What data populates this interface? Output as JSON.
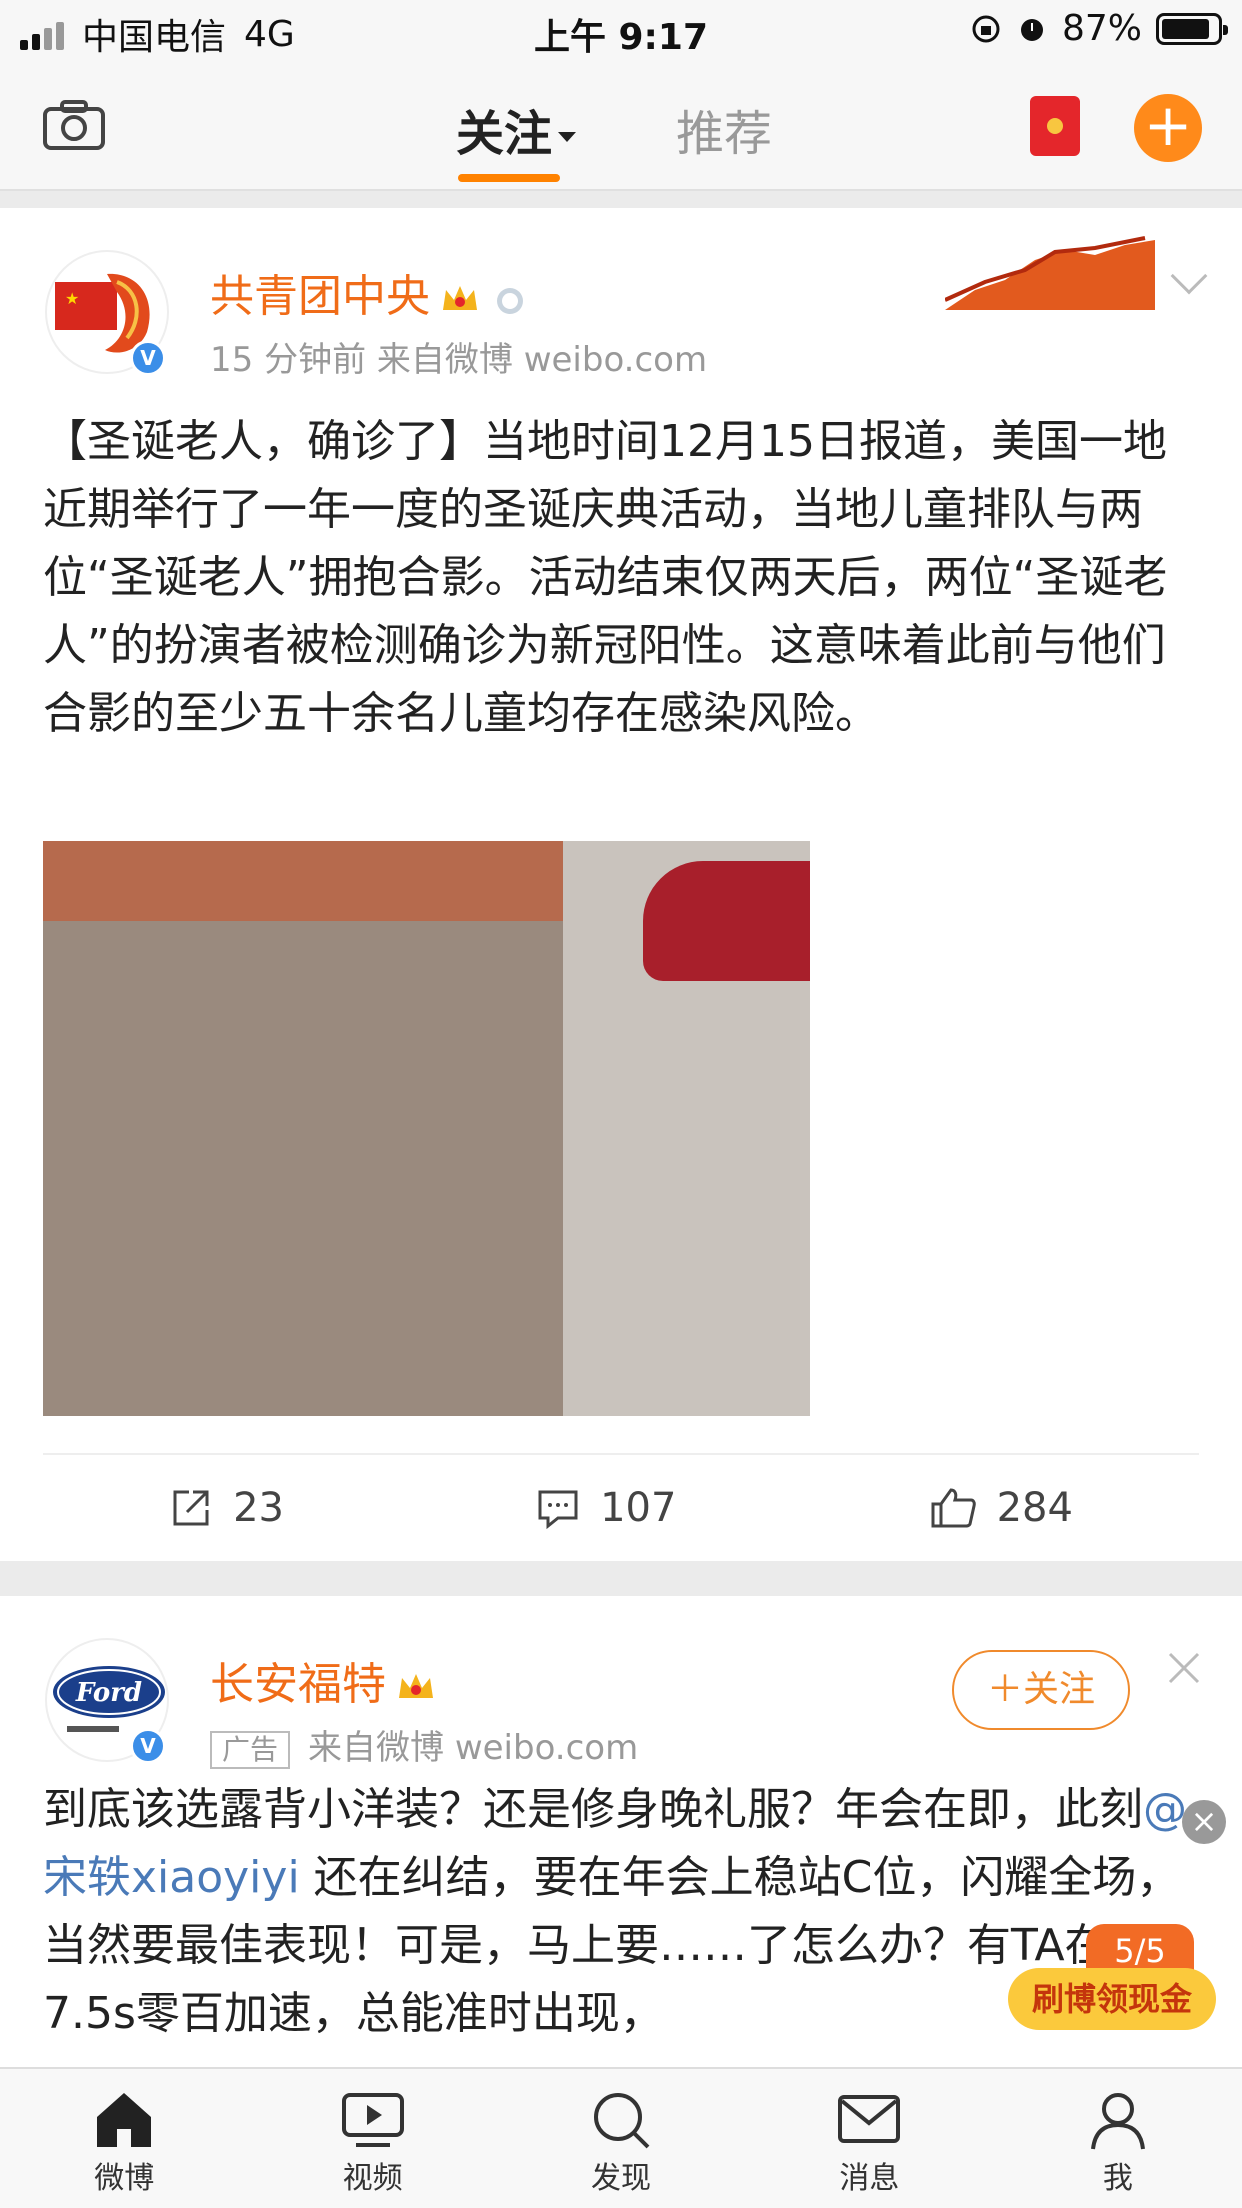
{
  "status_bar": {
    "carrier": "中国电信",
    "network": "4G",
    "time": "上午 9:17",
    "battery": "87%",
    "battery_level": 0.87
  },
  "top_nav": {
    "tab_follow": "关注",
    "tab_recommend": "推荐"
  },
  "post1": {
    "author": "共青团中央",
    "time": "15 分钟前",
    "source": "来自微博 weibo.com",
    "text": "【圣诞老人，确诊了】当地时间12月15日报道，美国一地近期举行了一年一度的圣诞庆典活动，当地儿童排队与两位“圣诞老人”拥抱合影。活动结束仅两天后，两位“圣诞老人”的扮演者被检测确诊为新冠阳性。这意味着此前与他们合影的至少五十余名儿童均存在感染风险。",
    "repost_count": "23",
    "comment_count": "107",
    "like_count": "284",
    "verified": "V"
  },
  "post2": {
    "author": "长安福特",
    "ad_tag": "广告",
    "source": "来自微博 weibo.com",
    "follow_label": "＋关注",
    "avatar_logo_text": "Ford",
    "text_a": "到底该选露背小洋装？还是修身晚礼服？年会在即，此刻",
    "mention": "@宋轶xiaoyiyi",
    "text_b": " 还在纠结，要在年会上稳站C位，闪耀全场，当然要最佳表现！可是，马上要……了怎么办？有TA在，7.5s零百加速，总能准时出现，",
    "verified": "V"
  },
  "promo": {
    "counter": "5/5",
    "label": "刷博领现金"
  },
  "tab_bar": [
    {
      "label": "微博",
      "icon": "home-icon"
    },
    {
      "label": "视频",
      "icon": "video-icon"
    },
    {
      "label": "发现",
      "icon": "search-icon"
    },
    {
      "label": "消息",
      "icon": "mail-icon"
    },
    {
      "label": "我",
      "icon": "profile-icon"
    }
  ],
  "colors": {
    "accent": "#ff8200",
    "name": "#f06c18",
    "mention": "#4a7ab8",
    "verified": "#3b8ee8"
  }
}
